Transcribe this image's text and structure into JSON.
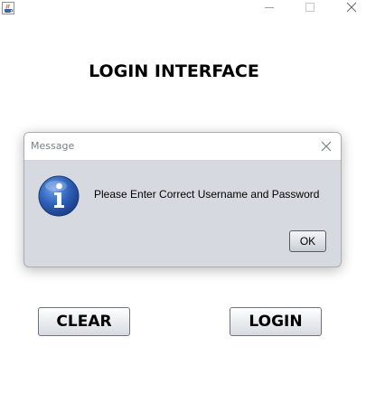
{
  "window": {
    "app_icon": "java-cup-icon",
    "controls": {
      "minimize": "minimize-icon",
      "maximize": "maximize-icon",
      "close": "close-icon"
    }
  },
  "main": {
    "title": "LOGIN INTERFACE",
    "clear_label": "CLEAR",
    "login_label": "LOGIN"
  },
  "dialog": {
    "title": "Message",
    "icon": "info-icon",
    "message": "Please Enter Correct Username and Password",
    "ok_label": "OK",
    "close_icon": "close-icon"
  },
  "colors": {
    "dialog_background": "#d6d9df",
    "info_icon_blue": "#2e62b9",
    "button_border": "#6f7379"
  }
}
